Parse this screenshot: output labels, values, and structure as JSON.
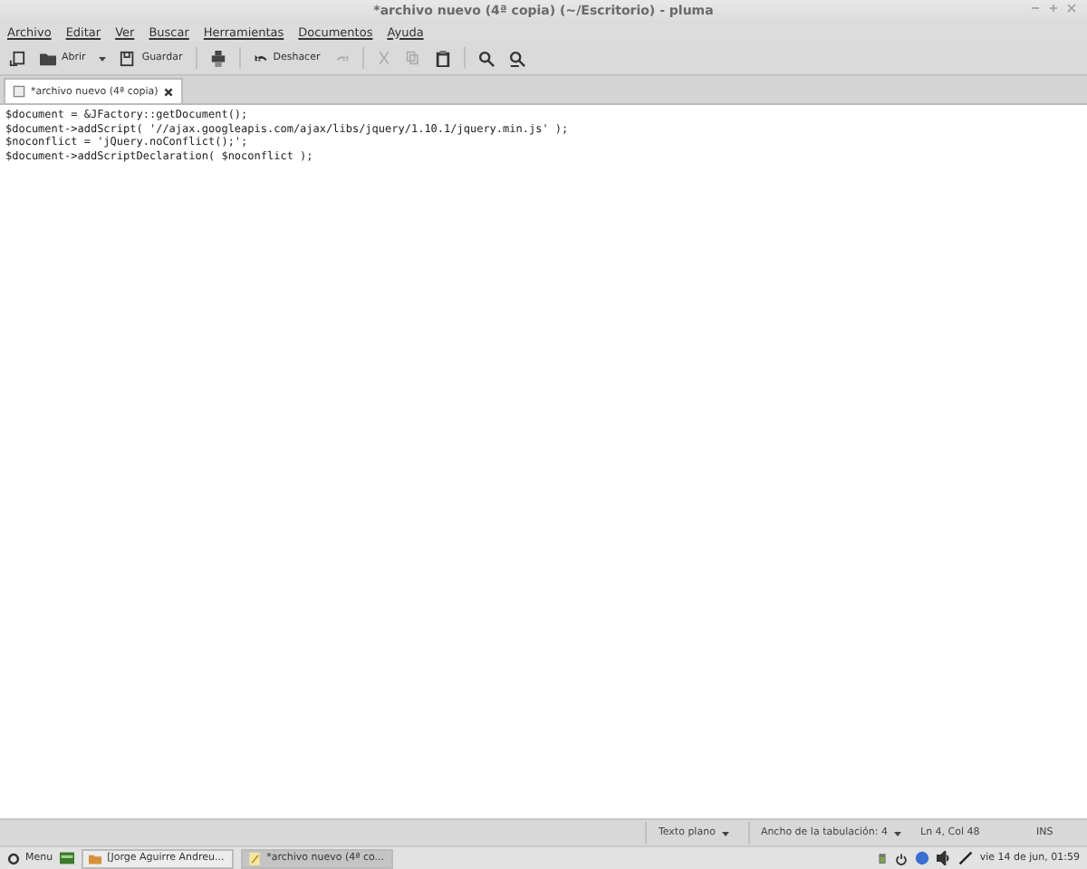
{
  "window": {
    "title": "*archivo nuevo (4ª copia) (~/Escritorio) - pluma"
  },
  "menu": [
    "Archivo",
    "Editar",
    "Ver",
    "Buscar",
    "Herramientas",
    "Documentos",
    "Ayuda"
  ],
  "toolbar": [
    {
      "kind": "new",
      "disabled": false
    },
    {
      "kind": "open",
      "label": "Abrir",
      "disabled": false
    },
    {
      "kind": "save",
      "label": "Guardar",
      "disabled": false
    },
    {
      "kind": "print",
      "disabled": false
    },
    {
      "kind": "undo",
      "label": "Deshacer",
      "disabled": false
    },
    {
      "kind": "redo",
      "disabled": true
    },
    {
      "kind": "cut",
      "disabled": true
    },
    {
      "kind": "copy",
      "disabled": true
    },
    {
      "kind": "paste",
      "disabled": false
    },
    {
      "kind": "find",
      "disabled": false
    },
    {
      "kind": "replace",
      "disabled": false
    }
  ],
  "tabs": [
    {
      "label": "*archivo nuevo (4ª copia)",
      "selected": true
    }
  ],
  "code_lines": [
    "$document = &JFactory::getDocument();",
    "$document->addScript( '//ajax.googleapis.com/ajax/libs/jquery/1.10.1/jquery.min.js' );",
    "$noconflict = 'jQuery.noConflict();';",
    "$document->addScriptDeclaration( $noconflict );"
  ],
  "status_bar": {
    "language": "Texto plano",
    "tab_width": "Ancho de la tabulación:  4",
    "position": "Ln 4, Col 48",
    "mode": "INS"
  },
  "taskbar": {
    "menu": "Menu",
    "windows": [
      {
        "label": "[Jorge Aguirre Andreu...",
        "selected": false
      },
      {
        "label": "*archivo nuevo (4ª co...",
        "selected": true
      }
    ],
    "clock": "vie 14 de jun, 01:59"
  }
}
